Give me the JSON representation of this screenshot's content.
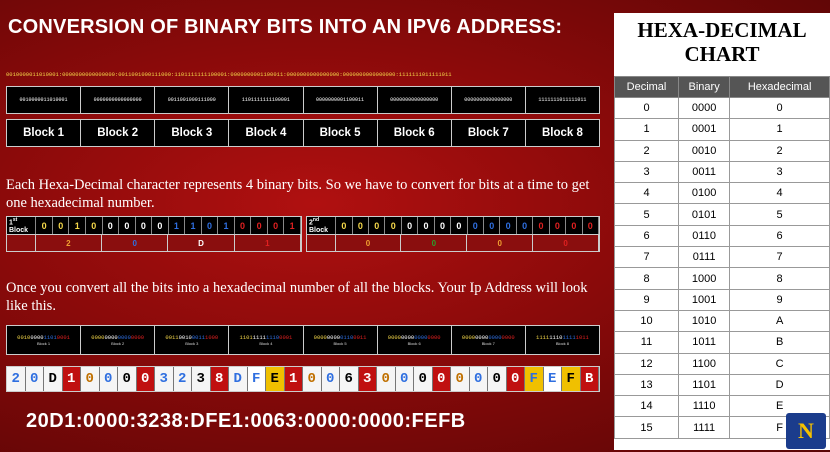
{
  "title": "CONVERSION OF BINARY BITS INTO AN IPV6 ADDRESS:",
  "bitstring": "0010000011010001:0000000000000000:0011001000111000:1101111111100001:0000000001100011:0000000000000000:0000000000000000:1111111011111011",
  "blocks_bits": [
    "0010000011010001",
    "0000000000000000",
    "0011001000111000",
    "1101111111100001",
    "0000000001100011",
    "0000000000000000",
    "0000000000000000",
    "1111111011111011"
  ],
  "block_labels": [
    "Block 1",
    "Block 2",
    "Block 3",
    "Block 4",
    "Block 5",
    "Block 6",
    "Block 7",
    "Block 8"
  ],
  "para1": "Each Hexa-Decimal character represents 4 binary bits. So we have to convert for bits at a time to get one hexadecimal number.",
  "example": [
    {
      "tag_num": "1",
      "tag_sup": "st",
      "tag_word": "Block",
      "bits": [
        "0",
        "0",
        "1",
        "0",
        "0",
        "0",
        "0",
        "0",
        "1",
        "1",
        "0",
        "1",
        "0",
        "0",
        "0",
        "1"
      ],
      "hex": [
        "2",
        "0",
        "D",
        "1"
      ]
    },
    {
      "tag_num": "2",
      "tag_sup": "nd",
      "tag_word": "Block",
      "bits": [
        "0",
        "0",
        "0",
        "0",
        "0",
        "0",
        "0",
        "0",
        "0",
        "0",
        "0",
        "0",
        "0",
        "0",
        "0",
        "0"
      ],
      "hex": [
        "0",
        "0",
        "0",
        "0"
      ]
    }
  ],
  "para2": "Once you convert all the bits into a hexadecimal number of all the blocks. Your Ip Address will look like this.",
  "color_blocks": [
    {
      "bits": "0010000011010001",
      "label": "Block 1"
    },
    {
      "bits": "0000000000000000",
      "label": "Block 2"
    },
    {
      "bits": "0011001000111000",
      "label": "Block 3"
    },
    {
      "bits": "1101111111100001",
      "label": "Block 4"
    },
    {
      "bits": "0000000001100011",
      "label": "Block 5"
    },
    {
      "bits": "0000000000000000",
      "label": "Block 6"
    },
    {
      "bits": "0000000000000000",
      "label": "Block 7"
    },
    {
      "bits": "1111111011111011",
      "label": "Block 8"
    }
  ],
  "hex_chars": [
    "2",
    "0",
    "D",
    "1",
    "0",
    "0",
    "0",
    "0",
    "3",
    "2",
    "3",
    "8",
    "D",
    "F",
    "E",
    "1",
    "0",
    "0",
    "6",
    "3",
    "0",
    "0",
    "0",
    "0",
    "0",
    "0",
    "0",
    "0",
    "F",
    "E",
    "F",
    "B"
  ],
  "ipv6": "20D1:0000:3238:DFE1:0063:0000:0000:FEFB",
  "chart": {
    "title": "HEXA-DECIMAL CHART",
    "headers": [
      "Decimal",
      "Binary",
      "Hexadecimal"
    ],
    "rows": [
      [
        "0",
        "0000",
        "0"
      ],
      [
        "1",
        "0001",
        "1"
      ],
      [
        "2",
        "0010",
        "2"
      ],
      [
        "3",
        "0011",
        "3"
      ],
      [
        "4",
        "0100",
        "4"
      ],
      [
        "5",
        "0101",
        "5"
      ],
      [
        "6",
        "0110",
        "6"
      ],
      [
        "7",
        "0111",
        "7"
      ],
      [
        "8",
        "1000",
        "8"
      ],
      [
        "9",
        "1001",
        "9"
      ],
      [
        "10",
        "1010",
        "A"
      ],
      [
        "11",
        "1011",
        "B"
      ],
      [
        "12",
        "1100",
        "C"
      ],
      [
        "13",
        "1101",
        "D"
      ],
      [
        "14",
        "1110",
        "E"
      ],
      [
        "15",
        "1111",
        "F"
      ]
    ]
  },
  "logo_glyph": "N",
  "colors": {
    "yellow": "#f5d84a",
    "blue": "#2f6fe0",
    "red": "#e02020",
    "green": "#2aa02a",
    "orange": "#f0a030"
  }
}
